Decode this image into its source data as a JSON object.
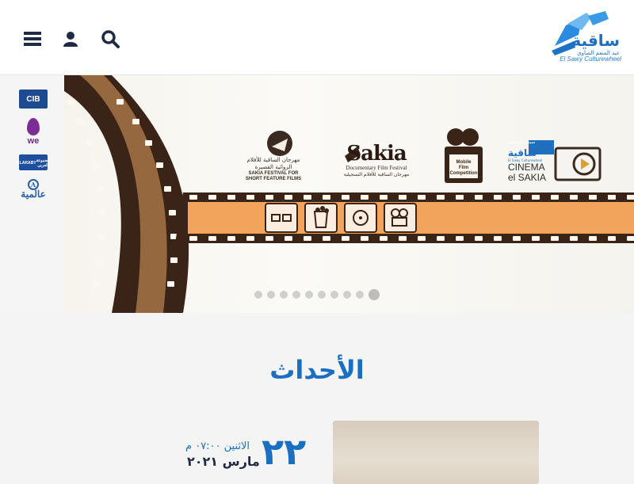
{
  "header": {
    "menu_icon": "menu-icon",
    "user_icon": "user-icon",
    "search_icon": "search-icon",
    "logo_arabic": "ساقية",
    "logo_arabic_sub": "عبد المنعم الصاوي",
    "logo_english": "El Sawy Culturewheel",
    "brand_color": "#2b8be0"
  },
  "sponsors": {
    "cib": "CIB",
    "we": "we",
    "elaraby_line1": "ELARABY",
    "elaraby_line2": "مجموعة العربي",
    "alamia": "عالمية"
  },
  "banner": {
    "festivals": [
      {
        "title_ar_1": "مهرجان الساقية للأفلام",
        "title_ar_2": "الروائية القصيرة",
        "title_en_1": "SAKIA FESTIVAL FOR",
        "title_en_2": "SHORT FEATURE FILMS"
      },
      {
        "big": "Sakia",
        "title_en": "Documentary Film Festival",
        "title_ar": "مهرجان الساقية للأفلام التسجيلية"
      },
      {
        "line1": "Mobile",
        "line2": "Film",
        "line3": "Competition"
      },
      {
        "title_ar": "سينما الساقية",
        "logo_ar": "ساقية",
        "sub_en": "El Sawy Culturewheel",
        "cinema_en_1": "CINEMA",
        "cinema_en_2": "el SAKIA"
      }
    ],
    "slide_count": 10,
    "active_slide": 10
  },
  "events": {
    "title": "الأحداث",
    "items": [
      {
        "day": "٢٢",
        "time": "الاثنين ٠٧:٠٠ م",
        "month_year": "مارس ٢٠٢١"
      }
    ]
  },
  "colors": {
    "accent": "#1a6fc0",
    "dark": "#1f2a44",
    "film_brown": "#3a2418",
    "film_orange": "#f2a35c"
  }
}
